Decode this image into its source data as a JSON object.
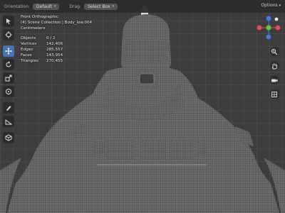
{
  "header": {
    "orientation_label": "Orientation:",
    "orientation_value": "Default",
    "drag_label": "Drag:",
    "drag_value": "Select Box",
    "options_label": "Options"
  },
  "overlay": {
    "view_name": "Front Orthographic",
    "collection_line": "(4) Scene Collection | Body_low.004",
    "units": "Centimeters",
    "stats": [
      {
        "label": "Objects",
        "value": "0 / 2"
      },
      {
        "label": "Vertices",
        "value": "142,406"
      },
      {
        "label": "Edges",
        "value": "285,557"
      },
      {
        "label": "Faces",
        "value": "143,954"
      },
      {
        "label": "Triangles",
        "value": "270,455"
      }
    ]
  },
  "gizmo": {
    "colors": {
      "x": "#e84a5f",
      "y": "#6bc04b",
      "z": "#3e7fe0",
      "center": "#e8e8e8"
    }
  },
  "colors": {
    "accent": "#4772b3",
    "viewport_bg": "#3d3d3d",
    "mesh": "#9a9a9a"
  },
  "icons": {
    "toolbar": [
      "select-cursor-icon",
      "cursor-icon",
      "move-icon",
      "rotate-icon",
      "scale-icon",
      "transform-icon",
      "annotate-icon",
      "measure-icon",
      "add-cube-icon"
    ],
    "nav": [
      "zoom-icon",
      "pan-hand-icon",
      "camera-icon",
      "grid-icon"
    ]
  }
}
